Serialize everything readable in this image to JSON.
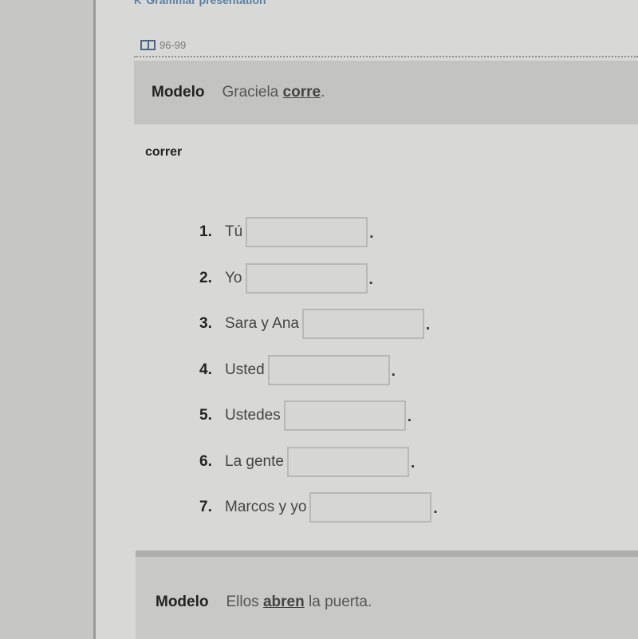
{
  "header": {
    "back_link_label": "Grammar presentation",
    "back_icon": "chevron-left-icon",
    "pages_icon": "book-icon",
    "pages_ref": "96-99"
  },
  "model_1": {
    "label": "Modelo",
    "sentence_before": "Graciela ",
    "sentence_verb": "corre",
    "sentence_after": "."
  },
  "verb": "correr",
  "items": [
    {
      "num": "1.",
      "subject": "Tú",
      "value": "",
      "end": "."
    },
    {
      "num": "2.",
      "subject": "Yo",
      "value": "",
      "end": "."
    },
    {
      "num": "3.",
      "subject": "Sara y Ana",
      "value": "",
      "end": "."
    },
    {
      "num": "4.",
      "subject": "Usted",
      "value": "",
      "end": "."
    },
    {
      "num": "5.",
      "subject": "Ustedes",
      "value": "",
      "end": "."
    },
    {
      "num": "6.",
      "subject": "La gente",
      "value": "",
      "end": "."
    },
    {
      "num": "7.",
      "subject": "Marcos y yo",
      "value": "",
      "end": "."
    }
  ],
  "model_2": {
    "label": "Modelo",
    "sentence_before": "Ellos ",
    "sentence_verb": "abren",
    "sentence_after": " la puerta."
  }
}
